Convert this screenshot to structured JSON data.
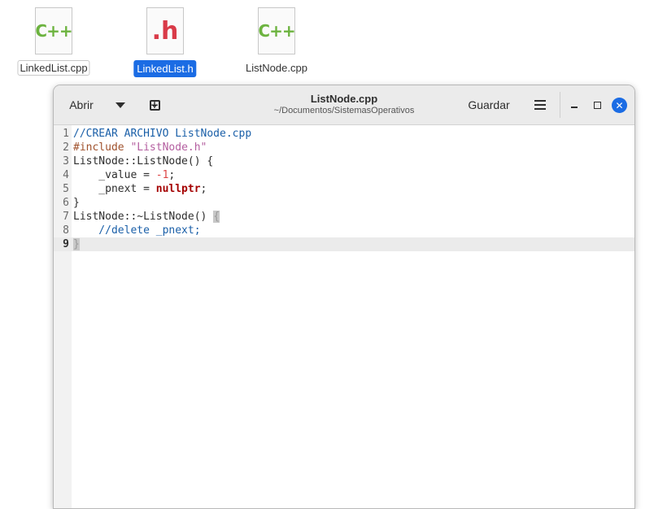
{
  "desktop": {
    "icons": [
      {
        "label": "LinkedList.cpp",
        "glyph": "C++"
      },
      {
        "label": "LinkedList.h",
        "glyph": ".h"
      },
      {
        "label": "ListNode.cpp",
        "glyph": "C++"
      }
    ]
  },
  "window": {
    "title": "ListNode.cpp",
    "subtitle": "~/Documentos/SistemasOperativos",
    "open_label": "Abrir",
    "save_label": "Guardar",
    "close_glyph": "✕",
    "new_tab_glyph": "+"
  },
  "editor": {
    "current_line": 9,
    "lines": [
      {
        "n": "1",
        "parts": [
          {
            "t": "//CREAR ARCHIVO ListNode.cpp",
            "c": "comment"
          }
        ]
      },
      {
        "n": "2",
        "parts": [
          {
            "t": "#include ",
            "c": "pre"
          },
          {
            "t": "\"ListNode.h\"",
            "c": "str"
          }
        ]
      },
      {
        "n": "3",
        "parts": [
          {
            "t": "ListNode::ListNode() {",
            "c": ""
          }
        ]
      },
      {
        "n": "4",
        "parts": [
          {
            "t": "    _value = ",
            "c": ""
          },
          {
            "t": "-1",
            "c": "num"
          },
          {
            "t": ";",
            "c": ""
          }
        ]
      },
      {
        "n": "5",
        "parts": [
          {
            "t": "    _pnext = ",
            "c": ""
          },
          {
            "t": "nullptr",
            "c": "kw"
          },
          {
            "t": ";",
            "c": ""
          }
        ]
      },
      {
        "n": "6",
        "parts": [
          {
            "t": "}",
            "c": ""
          }
        ]
      },
      {
        "n": "7",
        "parts": [
          {
            "t": "ListNode::~ListNode() ",
            "c": ""
          },
          {
            "t": "{",
            "c": "brace"
          }
        ]
      },
      {
        "n": "8",
        "parts": [
          {
            "t": "    //delete _pnext;",
            "c": "comment"
          }
        ]
      },
      {
        "n": "9",
        "parts": [
          {
            "t": "}",
            "c": "brace"
          }
        ]
      }
    ]
  }
}
